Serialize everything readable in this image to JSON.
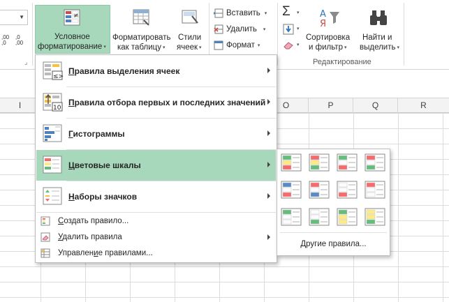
{
  "ribbon": {
    "number_format": {
      "dec_increase": ",00\n→,0",
      "dec_decrease": ",0\n→,00",
      "dec_increase_l1": ",00",
      "dec_increase_l2": ",0",
      "dec_decrease_l1": ",0",
      "dec_decrease_l2": ",00"
    },
    "conditional_formatting": {
      "line1": "Условное",
      "line2": "форматирование"
    },
    "format_as_table": {
      "line1": "Форматировать",
      "line2": "как таблицу"
    },
    "cell_styles": {
      "line1": "Стили",
      "line2": "ячеек"
    },
    "cells": {
      "insert": "Вставить",
      "delete": "Удалить",
      "format": "Формат"
    },
    "editing": {
      "sort_filter": {
        "line1": "Сортировка",
        "line2": "и фильтр"
      },
      "find_select": {
        "line1": "Найти и",
        "line2": "выделить"
      },
      "group_label": "Редактирование"
    }
  },
  "columns": [
    "I",
    "O",
    "P",
    "Q",
    "R"
  ],
  "menu": {
    "items": [
      {
        "label": "Правила выделения ячеек",
        "accel": "П",
        "rest": "равила выделения ячеек"
      },
      {
        "label": "Правила отбора первых и последних значений",
        "accel": "П",
        "rest": "равила отбора первых и последних значений"
      },
      {
        "label": "Гистограммы",
        "accel": "Г",
        "rest": "истограммы"
      },
      {
        "label": "Цветовые шкалы",
        "accel": "Ц",
        "rest": "ветовые шкалы"
      },
      {
        "label": "Наборы значков",
        "accel": "Н",
        "rest": "аборы значков"
      }
    ],
    "small_items": [
      {
        "pre": "",
        "accel": "С",
        "post": "оздать правило..."
      },
      {
        "pre": "",
        "accel": "У",
        "post": "далить правила"
      },
      {
        "pre": "Управлен",
        "accel": "и",
        "post": "е правилами..."
      }
    ]
  },
  "submenu": {
    "other_rules": "Другие правила...",
    "scales": [
      [
        "#63be7b",
        "#ffeb84",
        "#f8696b"
      ],
      [
        "#f8696b",
        "#ffeb84",
        "#63be7b"
      ],
      [
        "#63be7b",
        "#fcfcff",
        "#f8696b"
      ],
      [
        "#f8696b",
        "#fcfcff",
        "#63be7b"
      ],
      [
        "#5a8ac6",
        "#fcfcff",
        "#f8696b"
      ],
      [
        "#f8696b",
        "#fcfcff",
        "#5a8ac6"
      ],
      [
        "#fcfcff",
        "#fcfcff",
        "#f8696b"
      ],
      [
        "#f8696b",
        "#fcfcff",
        "#fcfcff"
      ],
      [
        "#63be7b",
        "#fcfcff",
        "#fcfcff"
      ],
      [
        "#fcfcff",
        "#fcfcff",
        "#63be7b"
      ],
      [
        "#63be7b",
        "#ffeb84",
        "#ffeb84"
      ],
      [
        "#ffeb84",
        "#ffeb84",
        "#63be7b"
      ]
    ]
  }
}
